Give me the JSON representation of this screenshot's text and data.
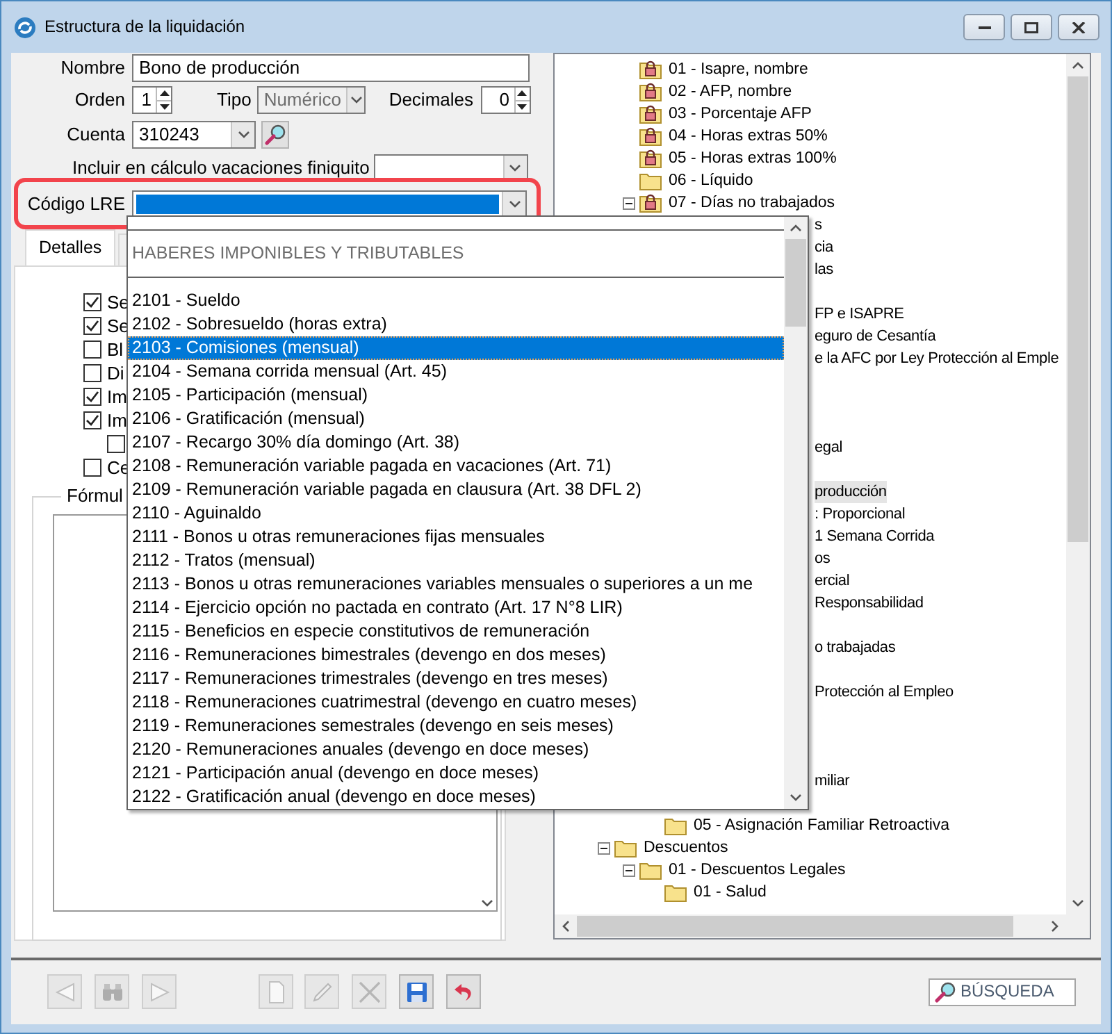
{
  "window": {
    "title": "Estructura de la liquidación"
  },
  "form": {
    "nombre": {
      "label": "Nombre",
      "value": "Bono de producción"
    },
    "orden": {
      "label": "Orden",
      "value": "1"
    },
    "tipo": {
      "label": "Tipo",
      "value": "Numérico",
      "disabled": true
    },
    "decimales": {
      "label": "Decimales",
      "value": "0"
    },
    "cuenta": {
      "label": "Cuenta",
      "value": "310243"
    },
    "incluir": {
      "label": "Incluir en cálculo vacaciones finiquito"
    },
    "codigo_lre": {
      "label": "Código LRE",
      "highlighted": true
    }
  },
  "tabs": [
    {
      "label": "Detalles",
      "selected": true
    },
    {
      "selected": false
    }
  ],
  "checkboxes": [
    {
      "label": "Se",
      "checked": true
    },
    {
      "label": "Se",
      "checked": true
    },
    {
      "label": "Bl",
      "checked": false
    },
    {
      "label": "Di",
      "checked": false
    },
    {
      "label": "Im",
      "checked": true
    },
    {
      "label": "Im",
      "checked": true,
      "children": [
        {
          "checked": false
        }
      ]
    },
    {
      "label": "Ce",
      "checked": false
    }
  ],
  "formula": {
    "label": "Fórmul"
  },
  "dropdown": {
    "items": [
      {
        "kind": "header",
        "label": "HABERES IMPONIBLES Y TRIBUTABLES"
      },
      {
        "kind": "option",
        "label": "2101 - Sueldo",
        "selected": false
      },
      {
        "kind": "option",
        "label": "2102 - Sobresueldo (horas extra)",
        "selected": false
      },
      {
        "kind": "option",
        "label": "2103 - Comisiones (mensual)",
        "selected": true
      },
      {
        "kind": "option",
        "label": "2104 - Semana corrida mensual (Art. 45)",
        "selected": false
      },
      {
        "kind": "option",
        "label": "2105 - Participación (mensual)",
        "selected": false
      },
      {
        "kind": "option",
        "label": "2106 - Gratificación (mensual)",
        "selected": false
      },
      {
        "kind": "option",
        "label": "2107 - Recargo 30% día domingo (Art. 38)",
        "selected": false
      },
      {
        "kind": "option",
        "label": "2108 - Remuneración variable pagada en vacaciones (Art. 71)",
        "selected": false
      },
      {
        "kind": "option",
        "label": "2109 - Remuneración variable pagada en clausura (Art. 38 DFL 2)",
        "selected": false
      },
      {
        "kind": "option",
        "label": "2110 - Aguinaldo",
        "selected": false
      },
      {
        "kind": "option",
        "label": "2111 - Bonos u otras remuneraciones fijas mensuales",
        "selected": false
      },
      {
        "kind": "option",
        "label": "2112 - Tratos (mensual)",
        "selected": false
      },
      {
        "kind": "option",
        "label": "2113 - Bonos u otras remuneraciones variables mensuales o superiores a un me",
        "selected": false
      },
      {
        "kind": "option",
        "label": "2114 - Ejercicio opción no pactada en contrato (Art. 17 N°8 LIR)",
        "selected": false
      },
      {
        "kind": "option",
        "label": "2115 - Beneficios en especie constitutivos de remuneración",
        "selected": false
      },
      {
        "kind": "option",
        "label": "2116 - Remuneraciones bimestrales (devengo en dos meses)",
        "selected": false
      },
      {
        "kind": "option",
        "label": "2117 - Remuneraciones trimestrales (devengo en tres meses)",
        "selected": false
      },
      {
        "kind": "option",
        "label": "2118 - Remuneraciones cuatrimestral (devengo en cuatro meses)",
        "selected": false
      },
      {
        "kind": "option",
        "label": "2119 - Remuneraciones semestrales (devengo en seis meses)",
        "selected": false
      },
      {
        "kind": "option",
        "label": "2120 - Remuneraciones anuales (devengo en doce meses)",
        "selected": false
      },
      {
        "kind": "option",
        "label": "2121 - Participación anual (devengo en doce meses)",
        "selected": false
      },
      {
        "kind": "option",
        "label": "2122 - Gratificación anual (devengo en doce meses)",
        "selected": false
      }
    ]
  },
  "tree": {
    "nodes": [
      {
        "kind": "continued",
        "children": [
          {
            "kind": "locked",
            "label": "01 - Isapre, nombre",
            "selected": false
          },
          {
            "kind": "locked",
            "label": "02 - AFP, nombre",
            "selected": false
          },
          {
            "kind": "locked",
            "label": "03 - Porcentaje AFP",
            "selected": false
          },
          {
            "kind": "locked",
            "label": "04 - Horas extras 50%",
            "selected": false
          },
          {
            "kind": "locked",
            "label": "05 - Horas extras 100%",
            "selected": false
          },
          {
            "kind": "folder",
            "label": "06 - Líquido",
            "selected": false
          },
          {
            "kind": "locked",
            "label": "07 - Días no trabajados",
            "selected": false,
            "expanded": true
          },
          {
            "kind": "fragment",
            "label": "s",
            "selected": false
          },
          {
            "kind": "fragment",
            "label": "cia",
            "selected": false
          },
          {
            "kind": "fragment",
            "label": "las",
            "selected": false
          },
          {
            "kind": "covered"
          },
          {
            "kind": "fragment",
            "label": "FP e ISAPRE",
            "selected": false
          },
          {
            "kind": "fragment",
            "label": "eguro de Cesantía",
            "selected": false
          },
          {
            "kind": "fragment",
            "label": "e la AFC por Ley Protección al Emple",
            "selected": false
          },
          {
            "kind": "covered"
          },
          {
            "kind": "covered"
          },
          {
            "kind": "covered"
          },
          {
            "kind": "fragment",
            "label": "egal",
            "selected": false
          },
          {
            "kind": "covered"
          },
          {
            "kind": "fragment",
            "label": "producción",
            "selected": true
          },
          {
            "kind": "fragment",
            "label": ": Proporcional",
            "selected": false
          },
          {
            "kind": "fragment",
            "label": "1 Semana Corrida",
            "selected": false
          },
          {
            "kind": "fragment",
            "label": "os",
            "selected": false
          },
          {
            "kind": "fragment",
            "label": "ercial",
            "selected": false
          },
          {
            "kind": "fragment",
            "label": "Responsabilidad",
            "selected": false
          },
          {
            "kind": "covered"
          },
          {
            "kind": "fragment",
            "label": "o trabajadas",
            "selected": false
          },
          {
            "kind": "covered"
          },
          {
            "kind": "fragment",
            "label": "Protección al Empleo",
            "selected": false
          },
          {
            "kind": "covered"
          },
          {
            "kind": "covered"
          },
          {
            "kind": "covered"
          },
          {
            "kind": "fragment",
            "label": "miliar",
            "selected": false,
            "children": [
              {
                "kind": "covered"
              },
              {
                "kind": "folder",
                "label": "05 - Asignación Familiar Retroactiva",
                "selected": false
              }
            ]
          }
        ]
      },
      {
        "kind": "folder",
        "label": "Descuentos",
        "selected": false,
        "expanded": true,
        "children": [
          {
            "kind": "folder",
            "label": "01 - Descuentos Legales",
            "selected": false,
            "expanded": true,
            "children": [
              {
                "kind": "folder",
                "label": "01 - Salud",
                "selected": false
              }
            ]
          }
        ]
      }
    ]
  },
  "toolbar": {
    "buttons": [
      {
        "kind": "previous",
        "disabled": true
      },
      {
        "kind": "find",
        "disabled": true
      },
      {
        "kind": "next",
        "disabled": true
      },
      {
        "kind": "new",
        "disabled": true
      },
      {
        "kind": "edit",
        "disabled": true
      },
      {
        "kind": "delete",
        "disabled": true
      },
      {
        "kind": "save",
        "disabled": false
      },
      {
        "kind": "undo",
        "disabled": false
      }
    ]
  },
  "search": {
    "placeholder": "BÚSQUEDA"
  }
}
